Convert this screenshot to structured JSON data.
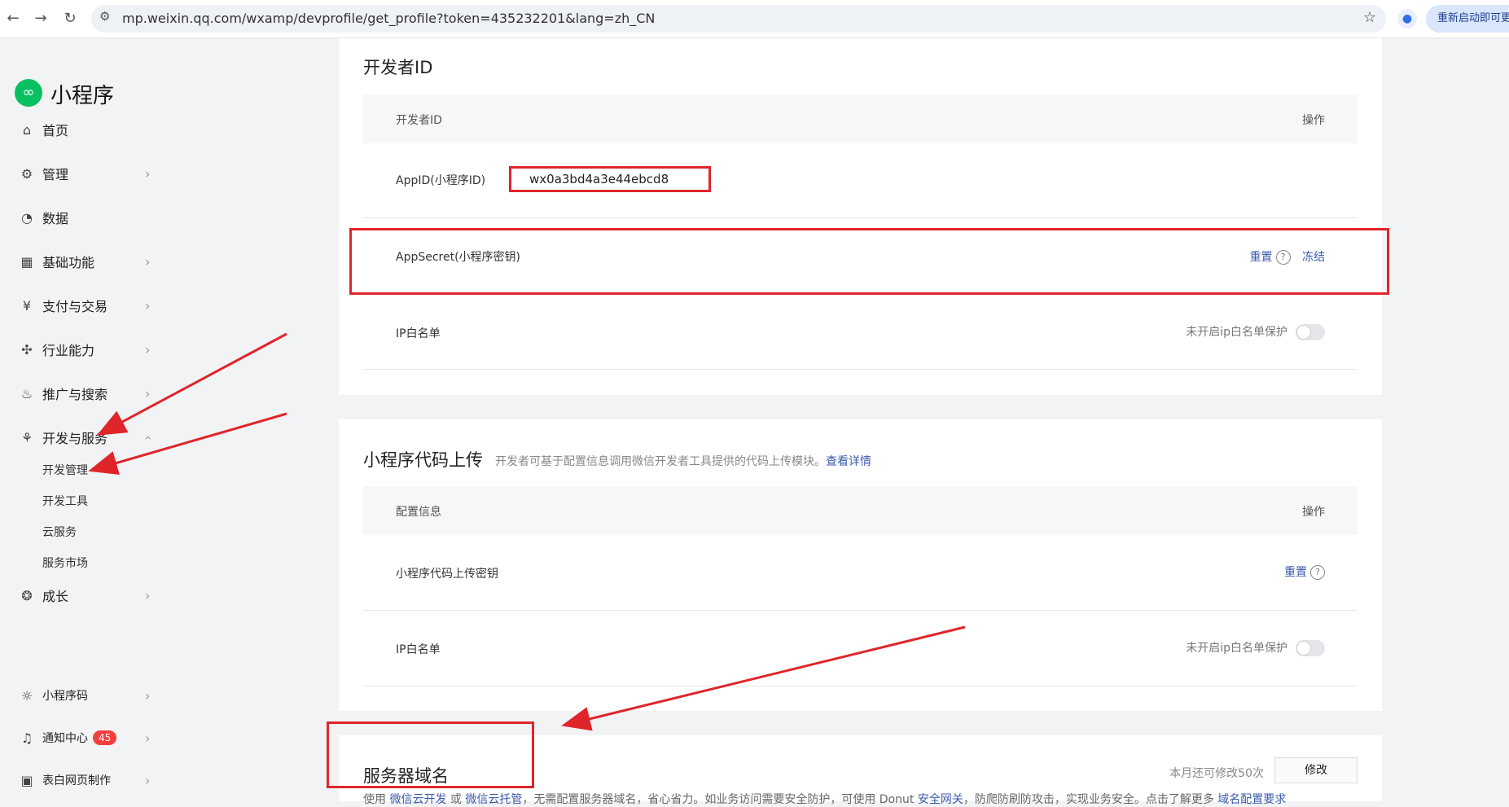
{
  "browser": {
    "url": "mp.weixin.qq.com/wxamp/devprofile/get_profile?token=435232201&lang=zh_CN",
    "restart_label": "重新启动即可更新"
  },
  "sidebar": {
    "brand": "小程序",
    "items": [
      {
        "label": "首页",
        "icon": "home-icon"
      },
      {
        "label": "管理",
        "icon": "settings-icon"
      },
      {
        "label": "数据",
        "icon": "chart-icon"
      },
      {
        "label": "基础功能",
        "icon": "grid-icon"
      },
      {
        "label": "支付与交易",
        "icon": "yen-icon"
      },
      {
        "label": "行业能力",
        "icon": "industry-icon"
      },
      {
        "label": "推广与搜索",
        "icon": "fire-icon"
      },
      {
        "label": "开发与服务",
        "icon": "dev-icon"
      }
    ],
    "sub_items": [
      "开发管理",
      "开发工具",
      "云服务",
      "服务市场"
    ],
    "growth": "成长",
    "bottom": [
      {
        "label": "小程序码",
        "icon": "sun-icon"
      },
      {
        "label": "通知中心",
        "icon": "bell-icon",
        "badge": "45"
      },
      {
        "label": "表白网页制作",
        "icon": "app-icon"
      }
    ]
  },
  "dev_id": {
    "title": "开发者ID",
    "head_left": "开发者ID",
    "head_right": "操作",
    "appid_label": "AppID(小程序ID)",
    "appid_value": "wx0a3bd4a3e44ebcd8",
    "secret_label": "AppSecret(小程序密钥)",
    "reset": "重置",
    "freeze": "冻结",
    "ip_label": "IP白名单",
    "ip_status": "未开启ip白名单保护"
  },
  "upload": {
    "title": "小程序代码上传",
    "desc": "开发者可基于配置信息调用微信开发者工具提供的代码上传模块。",
    "desc_link": "查看详情",
    "head_left": "配置信息",
    "head_right": "操作",
    "key_label": "小程序代码上传密钥",
    "reset": "重置",
    "ip_label": "IP白名单",
    "ip_status": "未开启ip白名单保护"
  },
  "server": {
    "title": "服务器域名",
    "remain": "本月还可修改50次",
    "edit": "修改",
    "desc_before_link1": "使用 ",
    "link1": "微信云开发",
    "or": " 或 ",
    "link2": "微信云托管",
    "desc_mid": "，无需配置服务器域名，省心省力。如业务访问需要安全防护，可使用 Donut ",
    "link3": "安全网关",
    "desc_end": "，防爬防刷防攻击，实现业务安全。点击了解更多 ",
    "link4": "域名配置要求"
  }
}
